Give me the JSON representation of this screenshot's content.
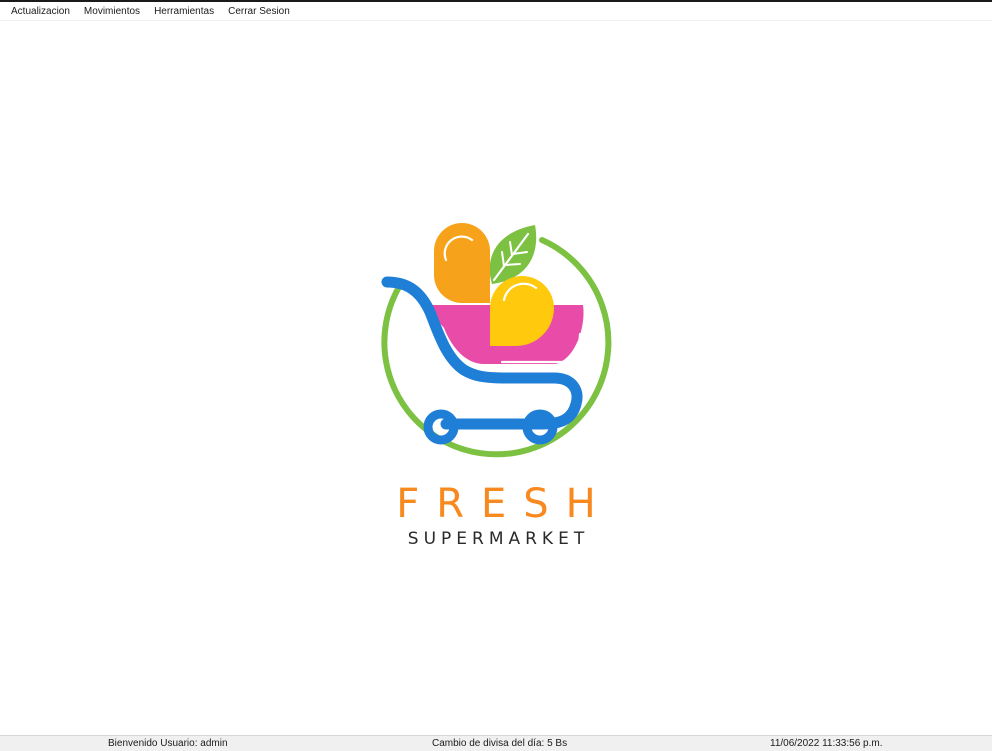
{
  "menu": {
    "items": [
      {
        "label": "Actualizacion"
      },
      {
        "label": "Movimientos"
      },
      {
        "label": "Herramientas"
      },
      {
        "label": "Cerrar Sesion"
      }
    ]
  },
  "logo": {
    "icon": "shopping-cart-with-fruit-icon",
    "brand_name": "FRESH",
    "brand_sub": "SUPERMARKET",
    "colors": {
      "ring": "#7dc142",
      "cart": "#1f7fd6",
      "basket": "#e84ca8",
      "orange": "#f7a21b",
      "lemon": "#ffc90e",
      "leaf": "#7dc142",
      "brand_text": "#f7891e",
      "sub_text": "#2a2a2a"
    }
  },
  "status": {
    "user": "Bienvenido Usuario: admin",
    "exchange_rate": "Cambio de divisa del día: 5 Bs",
    "datetime": "11/06/2022 11:33:56 p.m."
  }
}
